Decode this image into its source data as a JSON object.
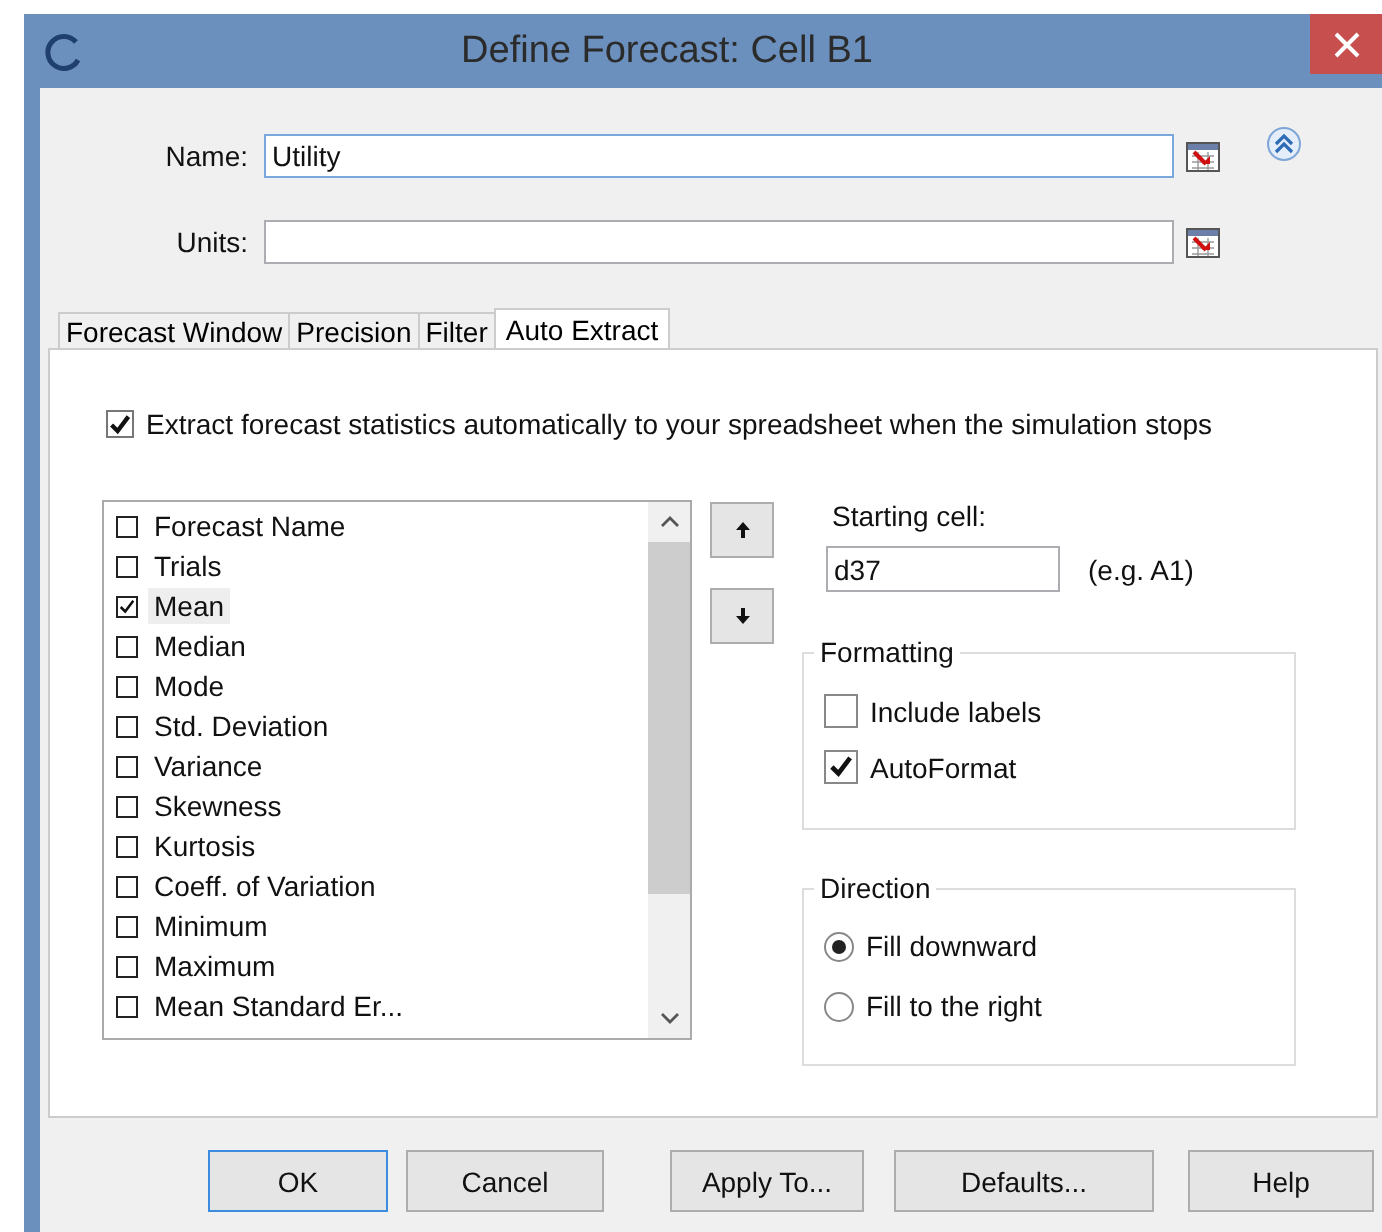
{
  "window": {
    "title": "Define Forecast: Cell B1"
  },
  "name_field": {
    "label": "Name:",
    "value": "Utility",
    "focused": true
  },
  "units_field": {
    "label": "Units:"
  },
  "tabs": [
    {
      "label": "Forecast Window",
      "selected": false
    },
    {
      "label": "Precision",
      "selected": false
    },
    {
      "label": "Filter",
      "selected": false
    },
    {
      "label": "Auto Extract",
      "selected": true
    }
  ],
  "extract_option": {
    "label": "Extract forecast statistics automatically to your spreadsheet when the simulation stops",
    "checked": true
  },
  "statistics": [
    {
      "label": "Forecast Name",
      "checked": false,
      "selected": false
    },
    {
      "label": "Trials",
      "checked": false,
      "selected": false
    },
    {
      "label": "Mean",
      "checked": true,
      "selected": true
    },
    {
      "label": "Median",
      "checked": false,
      "selected": false
    },
    {
      "label": "Mode",
      "checked": false,
      "selected": false
    },
    {
      "label": "Std. Deviation",
      "checked": false,
      "selected": false
    },
    {
      "label": "Variance",
      "checked": false,
      "selected": false
    },
    {
      "label": "Skewness",
      "checked": false,
      "selected": false
    },
    {
      "label": "Kurtosis",
      "checked": false,
      "selected": false
    },
    {
      "label": "Coeff. of Variation",
      "checked": false,
      "selected": false
    },
    {
      "label": "Minimum",
      "checked": false,
      "selected": false
    },
    {
      "label": "Maximum",
      "checked": false,
      "selected": false
    },
    {
      "label": "Mean Standard Er...",
      "checked": false,
      "selected": false
    }
  ],
  "starting_cell": {
    "label": "Starting cell:",
    "value": "d37",
    "hint": "(e.g. A1)"
  },
  "formatting": {
    "title": "Formatting",
    "options": [
      {
        "label": "Include labels",
        "checked": false
      },
      {
        "label": "AutoFormat",
        "checked": true
      }
    ]
  },
  "direction": {
    "title": "Direction",
    "options": [
      {
        "label": "Fill downward",
        "selected": true
      },
      {
        "label": "Fill to the right",
        "selected": false
      }
    ]
  },
  "buttons": [
    {
      "label": "OK",
      "default": true
    },
    {
      "label": "Cancel",
      "default": false
    },
    {
      "label": "Apply To...",
      "default": false
    },
    {
      "label": "Defaults...",
      "default": false
    },
    {
      "label": "Help",
      "default": false
    }
  ]
}
